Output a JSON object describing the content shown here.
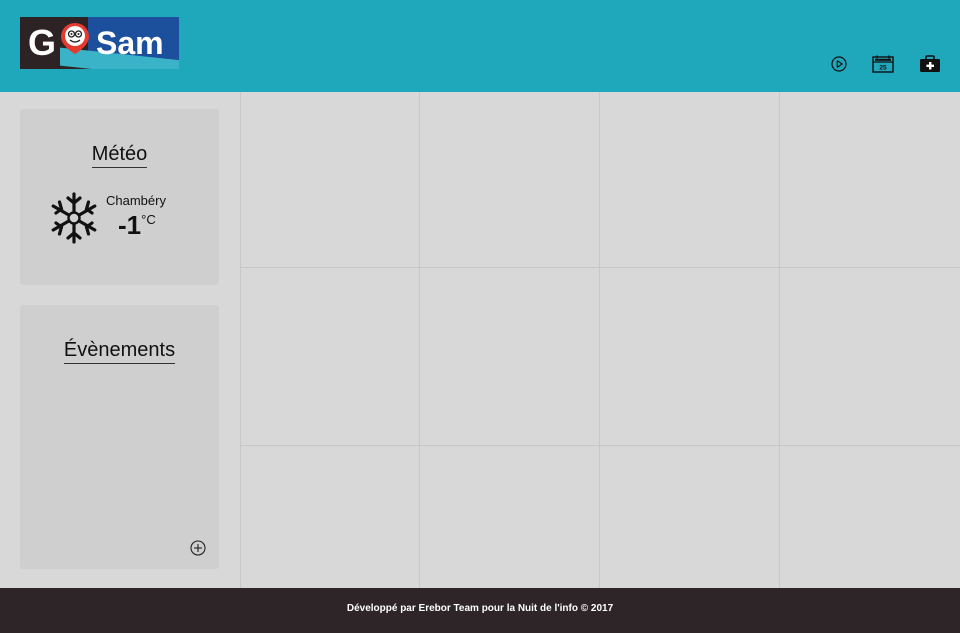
{
  "header": {
    "logo": {
      "letter": "G",
      "word": "Sam"
    },
    "icons": {
      "play": "play-circle-icon",
      "calendar": "calendar-icon",
      "first_aid": "first-aid-kit-icon"
    },
    "calendar_day": "25"
  },
  "weather": {
    "title": "Météo",
    "city": "Chambéry",
    "temperature": "-1",
    "unit": "°C",
    "icon": "snowflake-icon"
  },
  "events": {
    "title": "Évènements",
    "add_icon": "plus-circle-icon"
  },
  "footer": {
    "text": "Développé par Erebor Team pour la Nuit de l'info © 2017"
  },
  "colors": {
    "header": "#1fa7bc",
    "footer": "#2e2528",
    "card": "#cfcfcf",
    "page": "#d8d8d8"
  }
}
